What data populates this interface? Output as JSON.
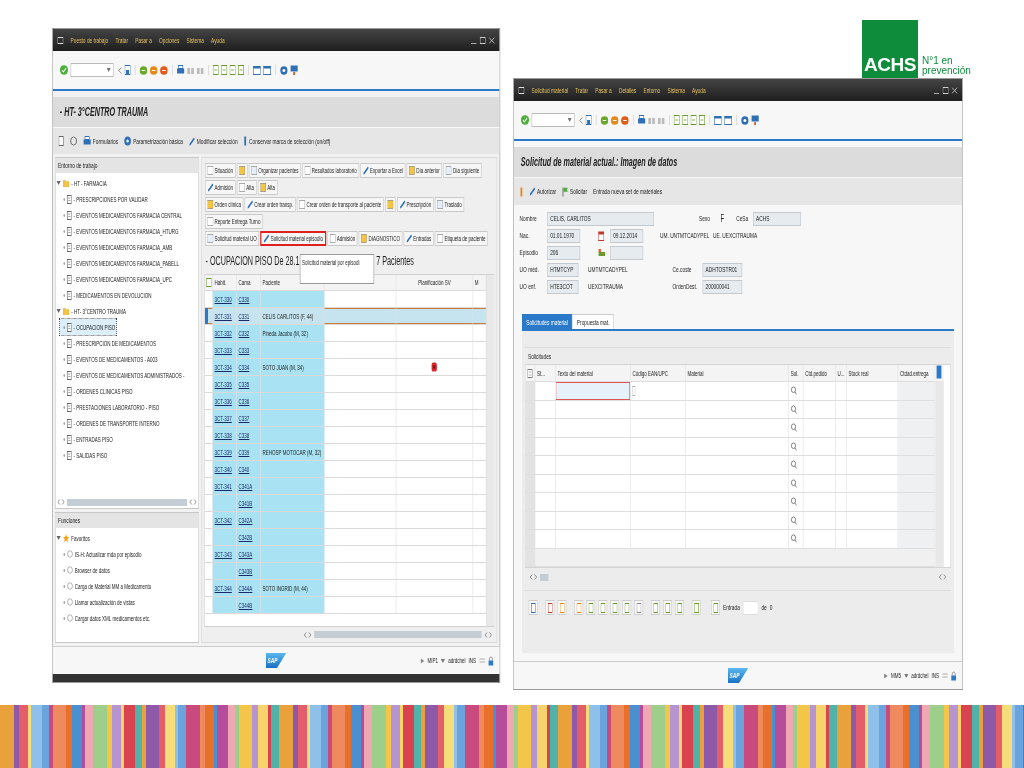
{
  "logo": {
    "mark": "ACHS",
    "tagline_1": "N°1 en",
    "tagline_2": "prevención"
  },
  "left_window": {
    "menu": [
      "Puesto de trabajo",
      "Tratar",
      "Pasar a",
      "Opciones",
      "Sistema",
      "Ayuda"
    ],
    "title": "- HT- 3°CENTRO TRAUMA",
    "toolbar": [
      "Formularios",
      "Parametrización básica",
      "Modificar selección",
      "Conservar marca de selección (on/off)"
    ],
    "worklist": {
      "title": "Entorno de trabajo",
      "tree": [
        {
          "label": "- HT - FARMACIA",
          "expanded": true,
          "children": [
            {
              "label": "- PRESCRIPCIONES POR VALIDAR",
              "selected": false
            },
            {
              "label": "- EVENTOS MEDICAMENTOS FARMACIA CENTRAL",
              "selected": false
            },
            {
              "label": "- EVENTOS MEDICAMENTOS FARMACIA_HTURG",
              "selected": false
            },
            {
              "label": "- EVENTOS MEDICAMENTOS FARMACIA_AMB",
              "selected": false
            },
            {
              "label": "- EVENTOS MEDICAMENTOS FARMACIA_PABELL",
              "selected": false
            },
            {
              "label": "- EVENTOS MEDICAMENTOS FARMACIA_UPC",
              "selected": false
            },
            {
              "label": "- MEDICAMENTOS EN DEVOLUCION",
              "selected": false
            }
          ]
        },
        {
          "label": "- HT- 3°CENTRO TRAUMA",
          "expanded": true,
          "children": [
            {
              "label": "- OCUPACION PISO",
              "selected": true
            },
            {
              "label": "- PRESCRIPCION DE MEDICAMENTOS",
              "selected": false
            },
            {
              "label": "- EVENTOS DE MEDICAMENTOS - A003",
              "selected": false
            },
            {
              "label": "- EVENTOS DE MEDICAMENTOS ADMINISTRADOS -",
              "selected": false
            },
            {
              "label": "- ORDENES CLINICAS PISO",
              "selected": false
            },
            {
              "label": "- PRESTACIONES LABORATORIO - PISO",
              "selected": false
            },
            {
              "label": "- ORDENES DE TRANSPORTE INTERNO",
              "selected": false
            },
            {
              "label": "- ENTRADAS PISO",
              "selected": false
            },
            {
              "label": "- SALIDAS PISO",
              "selected": false
            }
          ]
        }
      ]
    },
    "functions": {
      "title": "Funciones",
      "tree": [
        {
          "label": "Favoritos",
          "expanded": true,
          "children": [
            {
              "label": "IS-H: Actualizar mda por episodio",
              "selected": false
            },
            {
              "label": "Browser de datos",
              "selected": false
            },
            {
              "label": "Carga de Material MM a Medicamento",
              "selected": false
            },
            {
              "label": "Llamar actualización de vistas",
              "selected": false
            },
            {
              "label": "Cargar datos XML medicamentos etc.",
              "selected": false
            }
          ]
        }
      ]
    },
    "action_rows": [
      [
        {
          "kind": "text",
          "label": "Situación",
          "highlighted": false
        },
        {
          "kind": "icon",
          "highlighted": false
        },
        {
          "kind": "text",
          "label": "Organizar pacientes",
          "highlighted": false
        },
        {
          "kind": "text",
          "label": "Resultados laboratorio",
          "highlighted": false
        },
        {
          "kind": "text",
          "label": "Exportar a Excel",
          "highlighted": false
        },
        {
          "kind": "text",
          "label": "Día anterior",
          "highlighted": false
        },
        {
          "kind": "text",
          "label": "Día siguiente",
          "highlighted": false
        },
        {
          "kind": "text",
          "label": "Admisión",
          "highlighted": false
        },
        {
          "kind": "text",
          "label": "Alta",
          "highlighted": false
        },
        {
          "kind": "text",
          "label": "Alta",
          "highlighted": false
        }
      ],
      [
        {
          "kind": "text",
          "label": "Orden clínica",
          "highlighted": false
        },
        {
          "kind": "text",
          "label": "Crear orden transp.",
          "highlighted": false
        },
        {
          "kind": "text",
          "label": "Crear orden de transporte al paciente",
          "highlighted": false
        },
        {
          "kind": "icon",
          "highlighted": false
        },
        {
          "kind": "text",
          "label": "Prescripción",
          "highlighted": false
        },
        {
          "kind": "text",
          "label": "Traslado",
          "highlighted": false
        },
        {
          "kind": "text",
          "label": "Reporte Entrega Turno",
          "highlighted": false
        }
      ],
      [
        {
          "kind": "text",
          "label": "Solicitud material UO",
          "highlighted": false
        },
        {
          "kind": "text",
          "label": "Solicitud material episodio",
          "highlighted": true
        },
        {
          "kind": "text",
          "label": "Admisión",
          "highlighted": false
        },
        {
          "kind": "text",
          "label": "DIAGNOSTICO",
          "highlighted": false
        },
        {
          "kind": "text",
          "label": "Entradas",
          "highlighted": false
        },
        {
          "kind": "text",
          "label": "Etiqueta de paciente",
          "highlighted": false
        }
      ]
    ],
    "view_title": {
      "start": "- OCUPACION PISO De 28.1",
      "end": "7 Pacientes"
    },
    "tooltip": "Solicitud material por episodi",
    "table": {
      "headers": {
        "room": "Habit.",
        "bed": "Cama",
        "patient": "Paciente",
        "planning": "Planificación SV",
        "column_6": "M"
      },
      "rows": [
        {
          "room": "3CT-330",
          "bed": "C330",
          "selected": false,
          "alert": false
        },
        {
          "room": "3CT-331",
          "bed": "C331",
          "patient": "CELIS CARLITOS (F, 44)",
          "selected": true,
          "alert": false
        },
        {
          "room": "3CT-332",
          "bed": "C332",
          "patient": "Pineda Jacobo (M, 32)",
          "selected": false,
          "alert": false
        },
        {
          "room": "3CT-333",
          "bed": "C333",
          "selected": false,
          "alert": false
        },
        {
          "room": "3CT-334",
          "bed": "C334",
          "patient": "SOTO JUAN (M, 34)",
          "selected": false,
          "alert": true
        },
        {
          "room": "3CT-335",
          "bed": "C335",
          "selected": false,
          "alert": false
        },
        {
          "room": "3CT-336",
          "bed": "C336",
          "selected": false,
          "alert": false
        },
        {
          "room": "3CT-337",
          "bed": "C337",
          "selected": false,
          "alert": false
        },
        {
          "room": "3CT-338",
          "bed": "C338",
          "selected": false,
          "alert": false
        },
        {
          "room": "3CT-339",
          "bed": "C339",
          "patient": "REHOSP MOTOCAR (M, 32)",
          "selected": false,
          "alert": false
        },
        {
          "room": "3CT-340",
          "bed": "C340",
          "selected": false,
          "alert": false
        },
        {
          "room": "3CT-341",
          "bed": "C341A",
          "selected": false,
          "alert": false
        },
        {
          "bed": "C341B",
          "selected": false,
          "alert": false
        },
        {
          "room": "3CT-342",
          "bed": "C342A",
          "selected": false,
          "alert": false
        },
        {
          "bed": "C342B",
          "selected": false,
          "alert": false
        },
        {
          "room": "3CT-343",
          "bed": "C343A",
          "selected": false,
          "alert": false
        },
        {
          "bed": "C343B",
          "selected": false,
          "alert": false
        },
        {
          "room": "3CT-344",
          "bed": "C344A",
          "patient": "SOTO INGRID (M, 44)",
          "selected": false,
          "alert": false
        },
        {
          "bed": "C344B",
          "selected": false,
          "alert": false
        }
      ]
    },
    "status": {
      "logo": "SAP",
      "system": "MIP1",
      "user": "adrdchel",
      "mode": "INS"
    }
  },
  "right_window": {
    "menu": [
      "Solicitud material",
      "Tratar",
      "Pasar a",
      "Detalles",
      "Entorno",
      "Sistema",
      "Ayuda"
    ],
    "title": "Solicitud de material actual.: Imagen de datos",
    "toolbar": [
      "Autorizar",
      "Solicitar",
      "Entrada nueva set de materiales"
    ],
    "patient": {
      "name_label": "Nombre",
      "name": "CELIS, CARLITOS",
      "sex_label": "Sexo",
      "sex": "F",
      "cesa_label": "CeSa",
      "cesa": "ACHS",
      "birth_label": "Nac.",
      "birth": "01.01.1970",
      "admission_date": "09.12.2014",
      "um": "UM. UNTMTCADYPEL",
      "ue": "UE. UEXCITRAUMA",
      "episode_label": "Episodio",
      "episode": "206",
      "med_unit_label": "UO méd.",
      "med_unit": "HTMTCYP",
      "med_unit_text": "UMTMTCADYPEL",
      "cost_label": "Ce.coste",
      "cost": "ADHTOSTR01",
      "nurse_unit_label": "UO enf.",
      "nurse_unit": "HTE3COT",
      "nurse_unit_text": "UEXCITRAUMA",
      "order_label": "OrdenDest.",
      "order": "200000041"
    },
    "tabs": [
      {
        "label": "Solicitudes material",
        "selected": true
      },
      {
        "label": "Propuesta mat.",
        "selected": false
      }
    ],
    "table": {
      "title": "Solicitudes",
      "columns": [
        "St...",
        "Texto del material",
        "Código EAN/UPC",
        "Material",
        "Sol.",
        "Ctd.pedido",
        "U...",
        "Stock real",
        "Ctdad.entrega"
      ]
    },
    "pager": {
      "label": "Entrada",
      "of": "de",
      "total": "0"
    },
    "status": {
      "logo": "SAP",
      "system": "MM5",
      "user": "adrdchel",
      "mode": "INS"
    }
  }
}
